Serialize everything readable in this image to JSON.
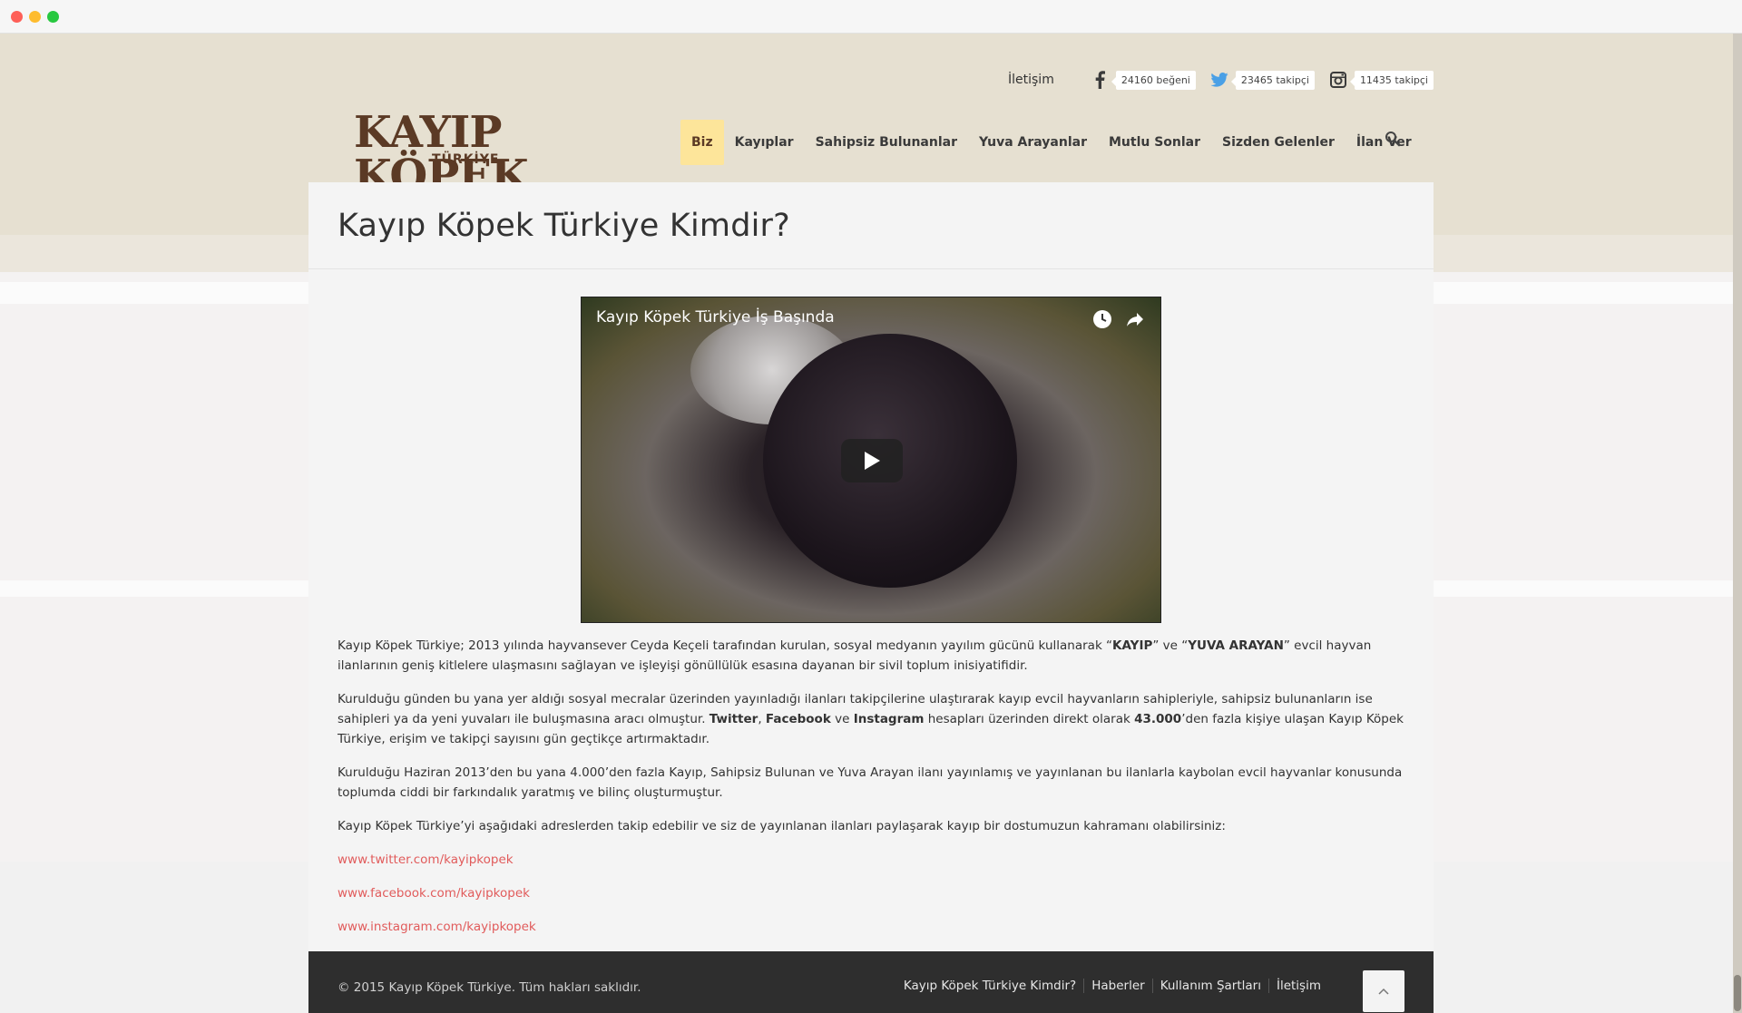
{
  "header": {
    "contact_label": "İletişim",
    "social": [
      {
        "icon": "facebook-icon",
        "count": "24160 beğeni",
        "color": "#3b3b3b",
        "glyph": "f"
      },
      {
        "icon": "twitter-icon",
        "count": "23465 takipçi",
        "color": "#4aa0e6",
        "glyph": "t"
      },
      {
        "icon": "instagram-icon",
        "count": "11435 takipçi",
        "color": "#3b3b3b",
        "glyph": "i"
      }
    ],
    "logo": {
      "line1": "KAYIP KÖPEK",
      "line2": "TÜRKİYE"
    },
    "nav": [
      {
        "label": "Biz",
        "active": true
      },
      {
        "label": "Kayıplar"
      },
      {
        "label": "Sahipsiz Bulunanlar"
      },
      {
        "label": "Yuva Arayanlar"
      },
      {
        "label": "Mutlu Sonlar"
      },
      {
        "label": "Sizden Gelenler"
      },
      {
        "label": "İlan Ver"
      }
    ]
  },
  "main": {
    "title": "Kayıp Köpek Türkiye Kimdir?",
    "video": {
      "title": "Kayıp Köpek Türkiye İş Başında"
    },
    "paragraphs": {
      "p1_a": "Kayıp Köpek Türkiye; 2013 yılında hayvansever Ceyda Keçeli tarafından kurulan, sosyal medyanın yayılım gücünü kullanarak “",
      "p1_b1": "KAYIP",
      "p1_c": "” ve “",
      "p1_b2": "YUVA ARAYAN",
      "p1_d": "” evcil hayvan ilanlarının geniş kitlelere ulaşmasını sağlayan ve işleyişi gönüllülük esasına dayanan bir sivil toplum inisiyatifidir.",
      "p2_a": "Kurulduğu günden bu yana yer aldığı sosyal mecralar üzerinden yayınladığı ilanları takipçilerine ulaştırarak kayıp evcil hayvanların sahipleriyle, sahipsiz bulunanların ise sahipleri ya da yeni yuvaları ile buluşmasına aracı olmuştur. ",
      "p2_b1": "Twitter",
      "p2_c": ", ",
      "p2_b2": "Facebook",
      "p2_d": " ve ",
      "p2_b3": "Instagram",
      "p2_e": " hesapları üzerinden direkt olarak ",
      "p2_b4": "43.000",
      "p2_f": "’den fazla kişiye ulaşan Kayıp Köpek Türkiye, erişim ve takipçi sayısını gün geçtikçe artırmaktadır.",
      "p3": "Kurulduğu Haziran 2013’den bu yana 4.000’den fazla Kayıp, Sahipsiz Bulunan ve Yuva Arayan ilanı yayınlamış ve yayınlanan bu ilanlarla kaybolan evcil hayvanlar konusunda toplumda ciddi bir farkındalık yaratmış ve bilinç oluşturmuştur.",
      "p4": "Kayıp Köpek Türkiye’yi aşağıdaki adreslerden takip edebilir ve siz de yayınlanan ilanları paylaşarak kayıp bir dostumuzun kahramanı olabilirsiniz:"
    },
    "links": [
      "www.twitter.com/kayipkopek",
      "www.facebook.com/kayipkopek",
      "www.instagram.com/kayipkopek"
    ]
  },
  "footer": {
    "copyright": "© 2015 Kayıp Köpek Türkiye. Tüm hakları saklıdır.",
    "links": [
      "Kayıp Köpek Türkiye Kimdir?",
      "Haberler",
      "Kullanım Şartları",
      "İletişim"
    ]
  },
  "colors": {
    "accent": "#fde59a",
    "link": "#e15b5b",
    "brand": "#5b3a25",
    "footer": "#2e2e2e"
  }
}
